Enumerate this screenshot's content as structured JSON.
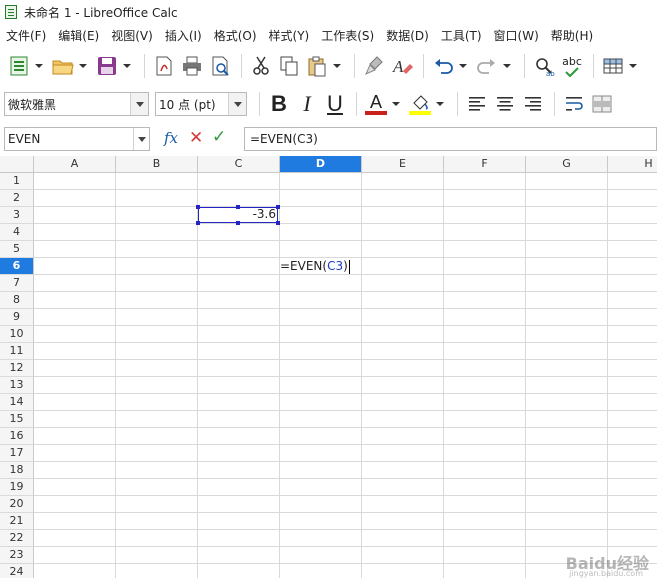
{
  "window": {
    "title": "未命名 1 - LibreOffice Calc"
  },
  "menubar": [
    "文件(F)",
    "编辑(E)",
    "视图(V)",
    "插入(I)",
    "格式(O)",
    "样式(Y)",
    "工作表(S)",
    "数据(D)",
    "工具(T)",
    "窗口(W)",
    "帮助(H)"
  ],
  "toolbar": {
    "font_name": "微软雅黑",
    "font_size": "10 点 (pt)",
    "bold": "B",
    "italic": "I",
    "underline": "U",
    "font_color_letter": "A",
    "font_color": "#c9211e",
    "highlight_color": "#ffff00",
    "spell_label": "abc"
  },
  "formula_bar": {
    "name_box": "EVEN",
    "fx_label": "fx",
    "cancel": "✕",
    "accept": "✓",
    "content": "=EVEN(C3)"
  },
  "sheet": {
    "columns": [
      "A",
      "B",
      "C",
      "D",
      "E",
      "F",
      "G",
      "H"
    ],
    "active_column": "D",
    "rows": [
      "1",
      "2",
      "3",
      "4",
      "5",
      "6",
      "7",
      "8",
      "9",
      "10",
      "11",
      "12",
      "13",
      "14",
      "15",
      "16",
      "17",
      "18",
      "19",
      "20",
      "21",
      "22",
      "23",
      "24"
    ],
    "active_row": "6",
    "cells": {
      "C3": "-3.6",
      "D6_prefix": "=EVEN(",
      "D6_ref": "C3",
      "D6_suffix": ")"
    }
  },
  "watermark": {
    "main": "Baidu经验",
    "sub": "jingyan.baidu.com"
  }
}
